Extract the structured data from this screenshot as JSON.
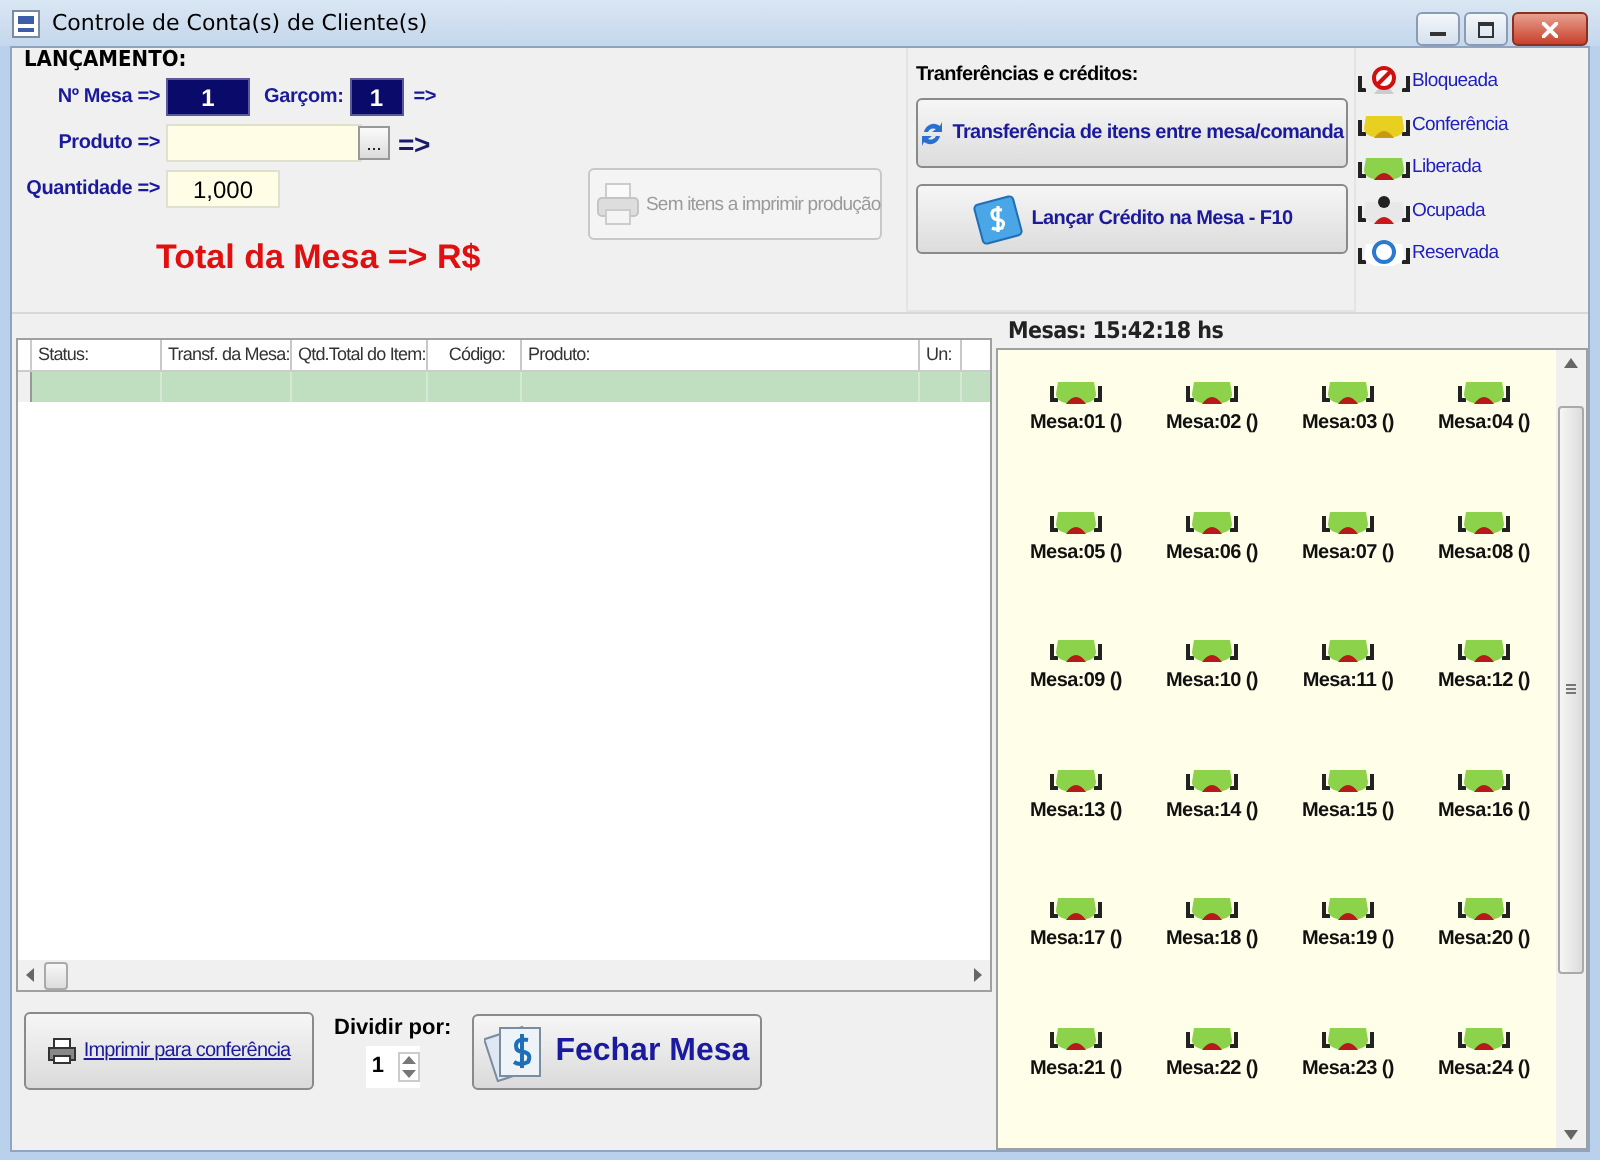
{
  "window": {
    "title": "Controle de Conta(s) de Cliente(s)"
  },
  "launch": {
    "heading": "LANÇAMENTO:",
    "mesa_label": "Nº Mesa =>",
    "mesa_value": "1",
    "garcom_label": "Garçom:",
    "garcom_value": "1",
    "garcom_arrow": "=>",
    "produto_label": "Produto =>",
    "produto_browse": "...",
    "produto_arrow": "=>",
    "quantidade_label": "Quantidade =>",
    "quantidade_value": "1,000",
    "total": "Total da Mesa => R$"
  },
  "print_production": {
    "label": "Sem itens a imprimir produção",
    "disabled": true
  },
  "transfers": {
    "heading": "Tranferências e créditos:",
    "transfer_button": "Transferência de itens entre mesa/comanda",
    "credit_button": "Lançar Crédito na Mesa - F10"
  },
  "legend": [
    {
      "kind": "bloqueada",
      "label": "Bloqueada"
    },
    {
      "kind": "conferencia",
      "label": "Conferência"
    },
    {
      "kind": "liberada",
      "label": "Liberada"
    },
    {
      "kind": "ocupada",
      "label": "Ocupada"
    },
    {
      "kind": "reservada",
      "label": "Reservada"
    }
  ],
  "table": {
    "columns": [
      "Status:",
      "Transf. da Mesa:",
      "Qtd.Total do Item:",
      "Código:",
      "Produto:",
      "Un:"
    ]
  },
  "footer": {
    "print_button": "Imprimir para conferência",
    "divide_label": "Dividir por:",
    "divide_value": "1",
    "close_button": "Fechar Mesa"
  },
  "tables_panel": {
    "heading": "Mesas: 15:42:18 hs",
    "tables": [
      {
        "label": "Mesa:01 ()",
        "kind": "liberada"
      },
      {
        "label": "Mesa:02 ()",
        "kind": "liberada"
      },
      {
        "label": "Mesa:03 ()",
        "kind": "liberada"
      },
      {
        "label": "Mesa:04 ()",
        "kind": "liberada"
      },
      {
        "label": "Mesa:05 ()",
        "kind": "liberada"
      },
      {
        "label": "Mesa:06 ()",
        "kind": "liberada"
      },
      {
        "label": "Mesa:07 ()",
        "kind": "liberada"
      },
      {
        "label": "Mesa:08 ()",
        "kind": "liberada"
      },
      {
        "label": "Mesa:09 ()",
        "kind": "liberada"
      },
      {
        "label": "Mesa:10 ()",
        "kind": "liberada"
      },
      {
        "label": "Mesa:11 ()",
        "kind": "liberada"
      },
      {
        "label": "Mesa:12 ()",
        "kind": "liberada"
      },
      {
        "label": "Mesa:13 ()",
        "kind": "liberada"
      },
      {
        "label": "Mesa:14 ()",
        "kind": "liberada"
      },
      {
        "label": "Mesa:15 ()",
        "kind": "liberada"
      },
      {
        "label": "Mesa:16 ()",
        "kind": "liberada"
      },
      {
        "label": "Mesa:17 ()",
        "kind": "liberada"
      },
      {
        "label": "Mesa:18 ()",
        "kind": "liberada"
      },
      {
        "label": "Mesa:19 ()",
        "kind": "liberada"
      },
      {
        "label": "Mesa:20 ()",
        "kind": "liberada"
      },
      {
        "label": "Mesa:21 ()",
        "kind": "liberada"
      },
      {
        "label": "Mesa:22 ()",
        "kind": "liberada"
      },
      {
        "label": "Mesa:23 ()",
        "kind": "liberada"
      },
      {
        "label": "Mesa:24 ()",
        "kind": "liberada"
      }
    ]
  }
}
